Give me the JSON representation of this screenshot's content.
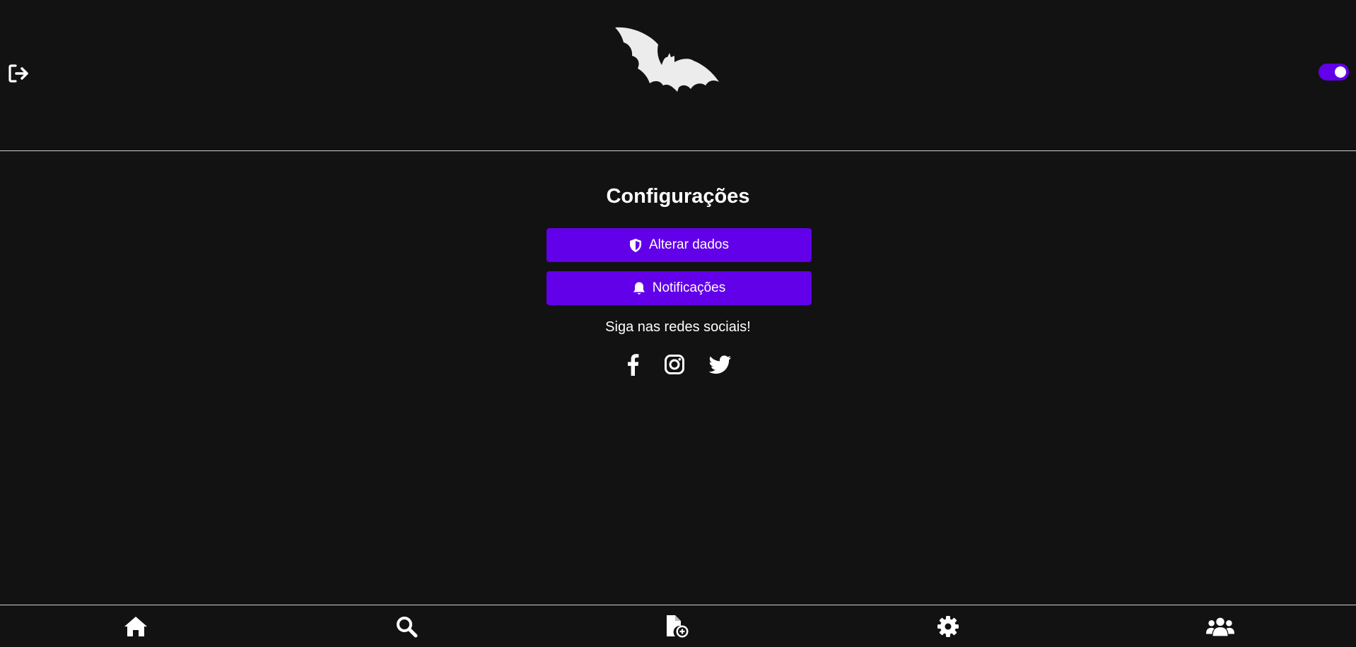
{
  "header": {
    "logout_icon": "sign-out-icon",
    "logo_icon": "bat-logo",
    "theme_toggle": {
      "state": "on",
      "color": "#6200ea"
    }
  },
  "main": {
    "title": "Configurações",
    "buttons": [
      {
        "label": "Alterar dados",
        "icon": "shield-icon"
      },
      {
        "label": "Notificações",
        "icon": "bell-icon"
      }
    ],
    "social_text": "Siga nas redes sociais!",
    "social_icons": [
      "facebook-icon",
      "instagram-icon",
      "twitter-icon"
    ]
  },
  "bottom_nav": {
    "items": [
      "home-icon",
      "search-icon",
      "new-file-icon",
      "gear-icon",
      "users-icon"
    ]
  },
  "colors": {
    "background": "#121212",
    "accent": "#6200ea",
    "text": "#ffffff",
    "divider": "#d0d0d0"
  }
}
